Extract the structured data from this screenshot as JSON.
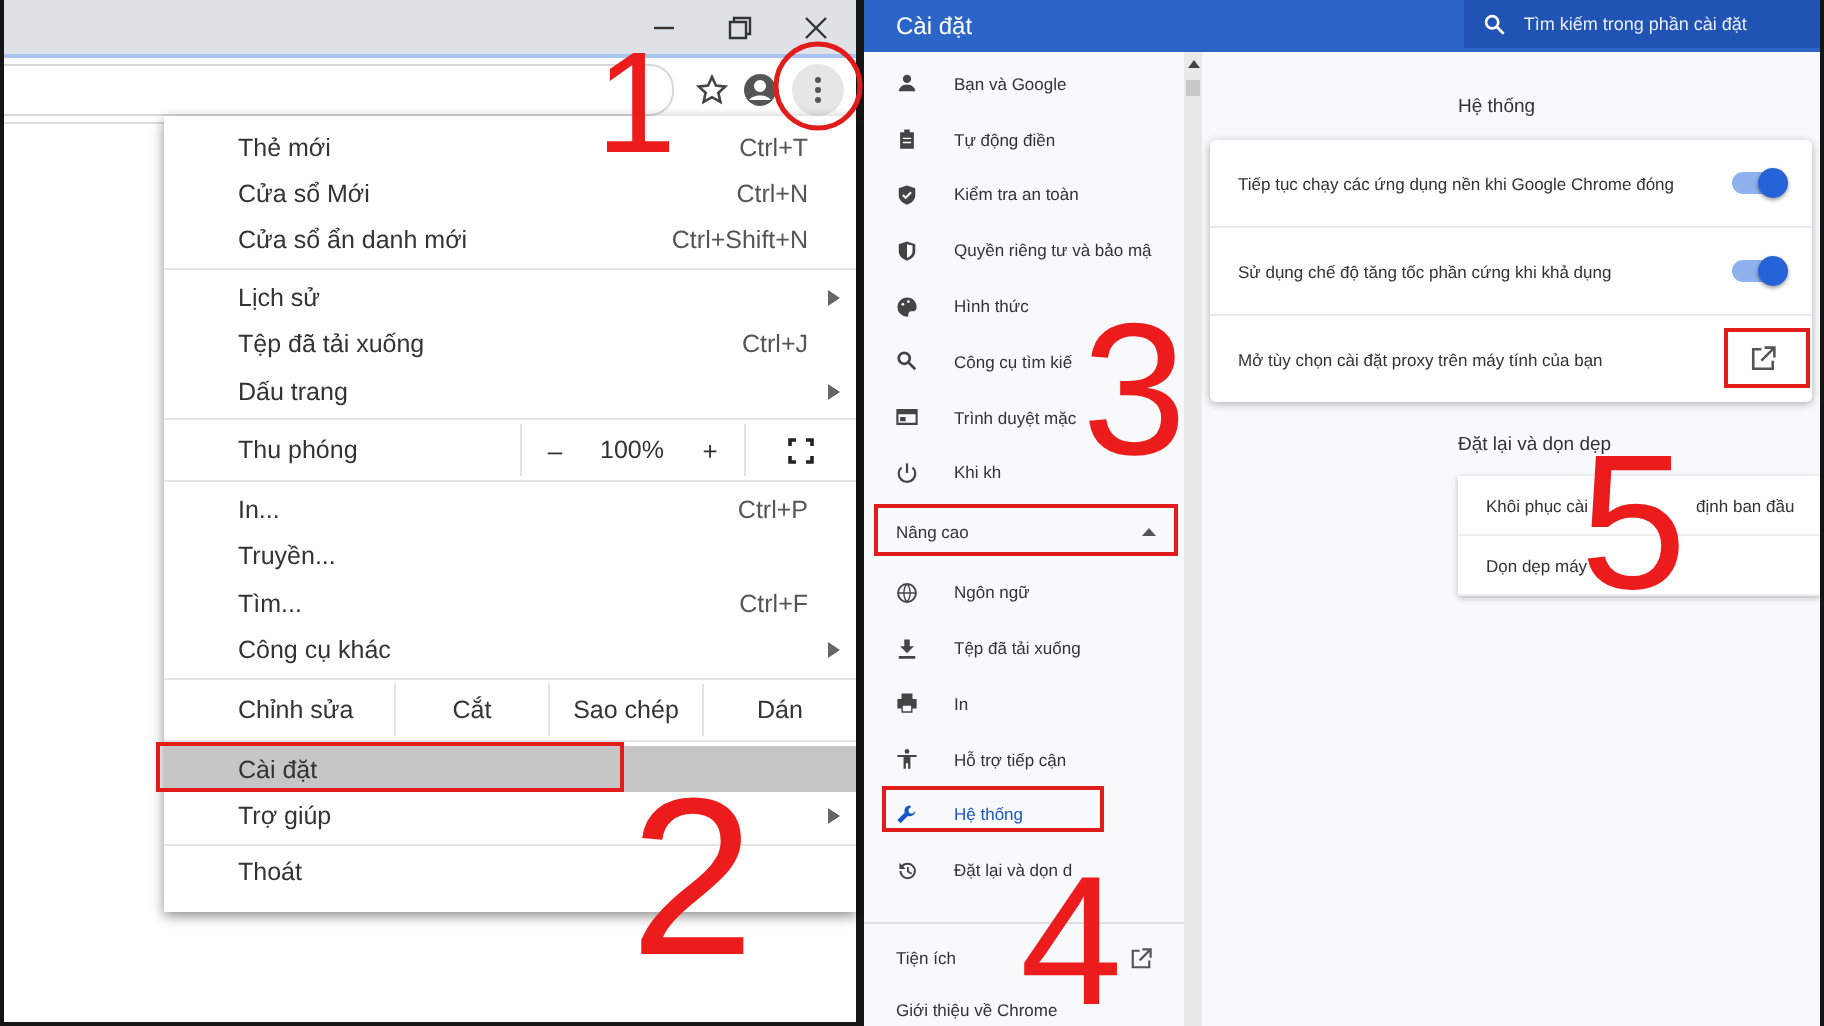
{
  "browser": {
    "menu": {
      "sections": [
        [
          {
            "kind": "item",
            "label": "Thẻ mới",
            "shortcut": "Ctrl+T",
            "submenu": false,
            "selected": false
          },
          {
            "kind": "item",
            "label": "Cửa sổ Mới",
            "shortcut": "Ctrl+N",
            "submenu": false,
            "selected": false
          },
          {
            "kind": "item",
            "label": "Cửa sổ ẩn danh mới",
            "shortcut": "Ctrl+Shift+N",
            "submenu": false,
            "selected": false
          }
        ],
        [
          {
            "kind": "item",
            "label": "Lịch sử",
            "submenu": true,
            "selected": false
          },
          {
            "kind": "item",
            "label": "Tệp đã tải xuống",
            "shortcut": "Ctrl+J",
            "submenu": false,
            "selected": false
          },
          {
            "kind": "item",
            "label": "Dấu trang",
            "submenu": true,
            "selected": false
          }
        ],
        [
          {
            "kind": "zoom",
            "label": "Thu phóng",
            "minus": "–",
            "value": "100%",
            "plus": "+"
          }
        ],
        [
          {
            "kind": "item",
            "label": "In...",
            "shortcut": "Ctrl+P",
            "submenu": false,
            "selected": false
          },
          {
            "kind": "item",
            "label": "Truyền...",
            "submenu": false,
            "selected": false
          },
          {
            "kind": "item",
            "label": "Tìm...",
            "shortcut": "Ctrl+F",
            "submenu": false,
            "selected": false
          },
          {
            "kind": "item",
            "label": "Công cụ khác",
            "submenu": true,
            "selected": false
          }
        ],
        [
          {
            "kind": "edit",
            "label": "Chỉnh sửa",
            "actions": [
              "Cắt",
              "Sao chép",
              "Dán"
            ]
          }
        ],
        [
          {
            "kind": "item",
            "label": "Cài đặt",
            "submenu": false,
            "selected": true
          },
          {
            "kind": "item",
            "label": "Trợ giúp",
            "submenu": true,
            "selected": false
          }
        ],
        [
          {
            "kind": "item",
            "label": "Thoát",
            "submenu": false,
            "selected": false
          }
        ]
      ]
    }
  },
  "settings": {
    "title": "Cài đặt",
    "search": {
      "placeholder": "Tìm kiếm trong phần cài đặt"
    },
    "sidebar": {
      "items": [
        {
          "label": "Bạn và Google",
          "selected": false
        },
        {
          "label": "Tự động điền",
          "selected": false
        },
        {
          "label": "Kiểm tra an toàn",
          "selected": false
        },
        {
          "label": "Quyền riêng tư và bảo mậ",
          "selected": false
        },
        {
          "label": "Hình thức",
          "selected": false
        },
        {
          "label": "Công cụ tìm kiế",
          "selected": false
        },
        {
          "label": "Trình duyệt mặc",
          "selected": false
        },
        {
          "label": "Khi kh",
          "selected": false
        }
      ],
      "advanced": {
        "label": "Nâng cao",
        "expanded": true,
        "items": [
          {
            "label": "Ngôn ngữ",
            "selected": false
          },
          {
            "label": "Tệp đã tải xuống",
            "selected": false
          },
          {
            "label": "In",
            "selected": false
          },
          {
            "label": "Hỗ trợ tiếp cận",
            "selected": false
          },
          {
            "label": "Hệ thống",
            "selected": true
          },
          {
            "label": "Đặt lại và dọn d",
            "selected": false
          }
        ]
      },
      "extensions": "Tiện ích",
      "about": "Giới thiệu về Chrome"
    },
    "system": {
      "title": "Hệ thống",
      "rows": [
        {
          "kind": "toggle",
          "label": "Tiếp tục chạy các ứng dụng nền khi Google Chrome đóng",
          "on": true
        },
        {
          "kind": "toggle",
          "label": "Sử dụng chế độ tăng tốc phần cứng khi khả dụng",
          "on": true
        },
        {
          "kind": "link",
          "label": "Mở tùy chọn cài đặt proxy trên máy tính của bạn"
        }
      ]
    },
    "reset": {
      "title": "Đặt lại và dọn dẹp",
      "rows": [
        {
          "parts": [
            "Khôi phục cài",
            "định ban đầu"
          ]
        },
        {
          "parts": [
            "Dọn dẹp máy"
          ]
        }
      ]
    }
  },
  "annotations": {
    "steps": [
      "1",
      "2",
      "3",
      "4",
      "5"
    ]
  }
}
